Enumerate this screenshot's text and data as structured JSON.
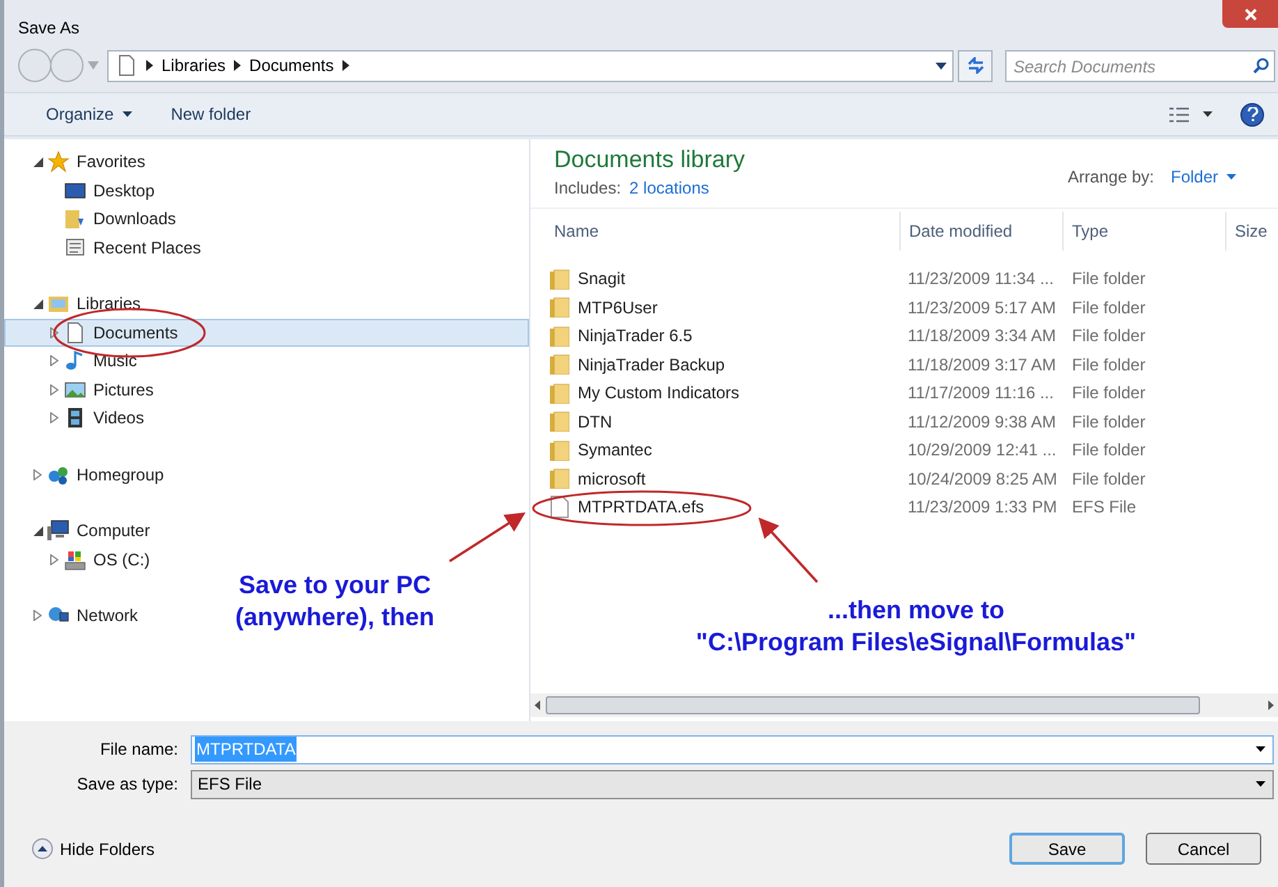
{
  "window": {
    "title": "Save As"
  },
  "address": {
    "crumbs": [
      "Libraries",
      "Documents"
    ],
    "search_placeholder": "Search Documents"
  },
  "toolbar": {
    "organize": "Organize",
    "new_folder": "New folder"
  },
  "nav": [
    {
      "label": "Favorites",
      "kind": "star",
      "expanded": true,
      "children": [
        {
          "label": "Desktop",
          "kind": "desktop"
        },
        {
          "label": "Downloads",
          "kind": "downloads"
        },
        {
          "label": "Recent Places",
          "kind": "recent"
        }
      ]
    },
    {
      "label": "Libraries",
      "kind": "library",
      "expanded": true,
      "children": [
        {
          "label": "Documents",
          "kind": "document",
          "expanded": false,
          "selected": true
        },
        {
          "label": "Music",
          "kind": "music",
          "expanded": false,
          "selected": false
        },
        {
          "label": "Pictures",
          "kind": "pictures",
          "expanded": false,
          "selected": false
        },
        {
          "label": "Videos",
          "kind": "videos",
          "expanded": false,
          "selected": false
        }
      ]
    },
    {
      "label": "Homegroup",
      "kind": "homegroup",
      "expanded": false
    },
    {
      "label": "Computer",
      "kind": "computer",
      "expanded": true,
      "children": [
        {
          "label": "OS (C:)",
          "kind": "drive",
          "expanded": false
        }
      ]
    },
    {
      "label": "Network",
      "kind": "network",
      "expanded": false
    }
  ],
  "library": {
    "title": "Documents library",
    "includes_label": "Includes:",
    "includes_link": "2 locations",
    "arrange_label": "Arrange by:",
    "arrange_value": "Folder"
  },
  "table": {
    "columns": [
      "Name",
      "Date modified",
      "Type",
      "Size"
    ],
    "rows": [
      {
        "kind": "folder",
        "name": "Snagit",
        "date": "11/23/2009 11:34 ...",
        "type": "File folder"
      },
      {
        "kind": "folder",
        "name": "MTP6User",
        "date": "11/23/2009 5:17 AM",
        "type": "File folder"
      },
      {
        "kind": "folder",
        "name": "NinjaTrader 6.5",
        "date": "11/18/2009 3:34 AM",
        "type": "File folder"
      },
      {
        "kind": "folder",
        "name": "NinjaTrader Backup",
        "date": "11/18/2009 3:17 AM",
        "type": "File folder"
      },
      {
        "kind": "folder",
        "name": "My Custom Indicators",
        "date": "11/17/2009 11:16 ...",
        "type": "File folder"
      },
      {
        "kind": "folder",
        "name": "DTN",
        "date": "11/12/2009 9:38 AM",
        "type": "File folder"
      },
      {
        "kind": "folder",
        "name": "Symantec",
        "date": "10/29/2009 12:41 ...",
        "type": "File folder"
      },
      {
        "kind": "folder",
        "name": "microsoft",
        "date": "10/24/2009 8:25 AM",
        "type": "File folder"
      },
      {
        "kind": "file",
        "name": "MTPRTDATA.efs",
        "date": "11/23/2009 1:33 PM",
        "type": "EFS File"
      }
    ]
  },
  "form": {
    "file_name_label": "File name:",
    "file_name": "MTPRTDATA",
    "type_label": "Save as type:",
    "type_value": "EFS File"
  },
  "footer": {
    "hide_folders": "Hide Folders",
    "buttons": [
      "Save",
      "Cancel"
    ]
  },
  "annotations": {
    "left": [
      "Save to your PC",
      "(anywhere), then"
    ],
    "right": [
      "...then move to",
      "\"C:\\Program Files\\eSignal\\Formulas\""
    ]
  }
}
